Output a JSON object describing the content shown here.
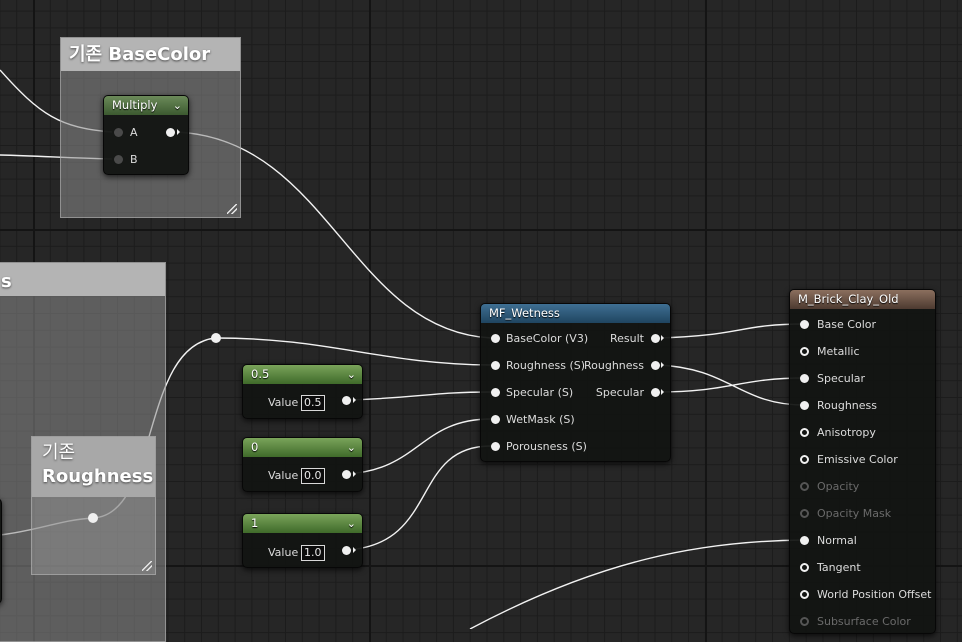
{
  "comments": {
    "basecolor_title": "기존 BaseColor",
    "roughness_title_line1": "기존",
    "roughness_title_line2": "Roughness",
    "left_partial_title": "s"
  },
  "multiply": {
    "title": "Multiply",
    "pin_a": "A",
    "pin_b": "B"
  },
  "constants": [
    {
      "title": "0.5",
      "value_label": "Value",
      "value": "0.5"
    },
    {
      "title": "0",
      "value_label": "Value",
      "value": "0.0"
    },
    {
      "title": "1",
      "value_label": "Value",
      "value": "1.0"
    }
  ],
  "wetness": {
    "title": "MF_Wetness",
    "inputs": [
      "BaseColor (V3)",
      "Roughness (S)",
      "Specular (S)",
      "WetMask (S)",
      "Porousness (S)"
    ],
    "outputs": [
      "Result",
      "Roughness",
      "Specular"
    ]
  },
  "material": {
    "title": "M_Brick_Clay_Old",
    "pins": [
      "Base Color",
      "Metallic",
      "Specular",
      "Roughness",
      "Anisotropy",
      "Emissive Color",
      "Opacity",
      "Opacity Mask",
      "Normal",
      "Tangent",
      "World Position Offset",
      "Subsurface Color"
    ]
  },
  "colors": {
    "grid_bg": "#262626",
    "constant_header": "#4f7a37",
    "function_header": "#2f5a78",
    "material_header": "#6d5446",
    "wire": "#ffffff"
  }
}
